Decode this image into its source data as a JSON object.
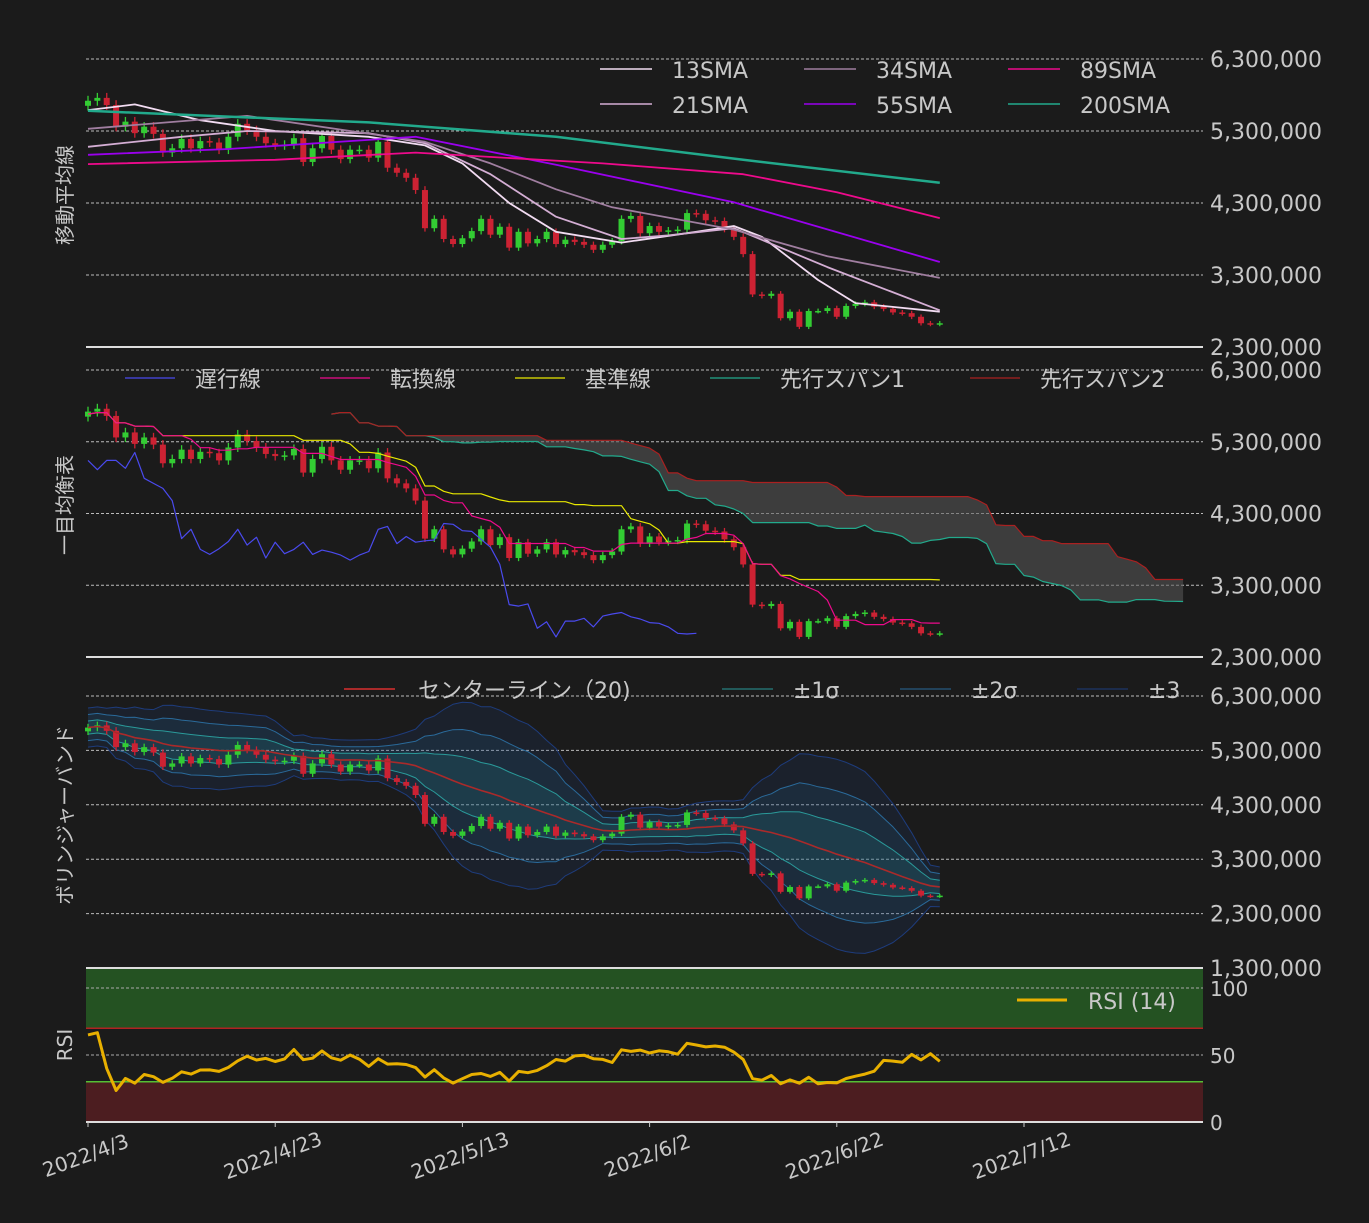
{
  "chart_data": [
    {
      "type": "candlestick",
      "panel": "moving-average",
      "ylabel": "移動平均線",
      "yticks": [
        "2,300,000",
        "3,300,000",
        "4,300,000",
        "5,300,000",
        "6,300,000"
      ],
      "ylim": [
        2300000,
        6300000
      ],
      "legend": [
        "13SMA",
        "21SMA",
        "34SMA",
        "55SMA",
        "89SMA",
        "200SMA"
      ],
      "legend_position": "top-right",
      "sma_series": [
        {
          "name": "13SMA",
          "color": "#f2dcf2",
          "points": [
            [
              0,
              5590000
            ],
            [
              5,
              5670000
            ],
            [
              12,
              5450000
            ],
            [
              20,
              5300000
            ],
            [
              30,
              5220000
            ],
            [
              36,
              5100000
            ],
            [
              40,
              4850000
            ],
            [
              45,
              4300000
            ],
            [
              50,
              3900000
            ],
            [
              57,
              3750000
            ],
            [
              65,
              3900000
            ],
            [
              69,
              3980000
            ],
            [
              72,
              3830000
            ],
            [
              78,
              3230000
            ],
            [
              82,
              2910000
            ],
            [
              91,
              2790000
            ]
          ]
        },
        {
          "name": "21SMA",
          "color": "#d4aed4",
          "points": [
            [
              0,
              5080000
            ],
            [
              10,
              5220000
            ],
            [
              17,
              5300000
            ],
            [
              30,
              5270000
            ],
            [
              36,
              5130000
            ],
            [
              43,
              4700000
            ],
            [
              50,
              4110000
            ],
            [
              57,
              3800000
            ],
            [
              62,
              3850000
            ],
            [
              69,
              3950000
            ],
            [
              79,
              3410000
            ],
            [
              91,
              2810000
            ]
          ]
        },
        {
          "name": "34SMA",
          "color": "#a07ea0",
          "points": [
            [
              0,
              5330000
            ],
            [
              17,
              5510000
            ],
            [
              28,
              5300000
            ],
            [
              36,
              5150000
            ],
            [
              43,
              4850000
            ],
            [
              50,
              4490000
            ],
            [
              56,
              4240000
            ],
            [
              69,
              3930000
            ],
            [
              79,
              3560000
            ],
            [
              91,
              3260000
            ]
          ]
        },
        {
          "name": "55SMA",
          "color": "#9a00ee",
          "points": [
            [
              0,
              4970000
            ],
            [
              15,
              5050000
            ],
            [
              35,
              5220000
            ],
            [
              50,
              4830000
            ],
            [
              69,
              4310000
            ],
            [
              91,
              3480000
            ]
          ]
        },
        {
          "name": "89SMA",
          "color": "#ee0a8c",
          "points": [
            [
              0,
              4840000
            ],
            [
              20,
              4900000
            ],
            [
              35,
              5000000
            ],
            [
              55,
              4850000
            ],
            [
              70,
              4700000
            ],
            [
              80,
              4450000
            ],
            [
              91,
              4090000
            ]
          ]
        },
        {
          "name": "200SMA",
          "color": "#22aa8c",
          "points": [
            [
              0,
              5580000
            ],
            [
              30,
              5420000
            ],
            [
              50,
              5220000
            ],
            [
              70,
              4900000
            ],
            [
              91,
              4580000
            ]
          ]
        }
      ]
    },
    {
      "type": "candlestick",
      "panel": "ichimoku",
      "ylabel": "一目均衡表",
      "yticks": [
        "2,300,000",
        "3,300,000",
        "4,300,000",
        "5,300,000",
        "6,300,000"
      ],
      "ylim": [
        2300000,
        6300000
      ],
      "legend": [
        "遅行線",
        "転換線",
        "基準線",
        "先行スパン1",
        "先行スパン2"
      ],
      "legend_position": "top",
      "periods": {
        "tenkan": 9,
        "kijun": 26,
        "span2": 52,
        "shift": 26
      },
      "colors": {
        "chikou": "#4a4aee",
        "tenkan": "#ee0a8c",
        "kijun": "#e8e800",
        "span1": "#22aa8c",
        "span2": "#aa2020",
        "cloud": "#5a5a5a"
      }
    },
    {
      "type": "candlestick",
      "panel": "bollinger",
      "ylabel": "ボリンジャーバンド",
      "yticks": [
        "1,300,000",
        "2,300,000",
        "3,300,000",
        "4,300,000",
        "5,300,000",
        "6,300,000"
      ],
      "ylim": [
        1300000,
        6300000
      ],
      "legend": [
        "センターライン（20)",
        "±1σ",
        "±2σ",
        "±3"
      ],
      "legend_position": "top-right",
      "period": 20,
      "colors": {
        "center": "#aa2a2a",
        "s1": "#2a9a9a",
        "s2": "#2a6a9a",
        "s3": "#1e3c7c"
      }
    },
    {
      "type": "line",
      "panel": "rsi",
      "ylabel": "RSI",
      "yticks": [
        "0",
        "50",
        "100"
      ],
      "ylim": [
        0,
        115
      ],
      "legend": [
        "RSI (14)"
      ],
      "legend_position": "top-right",
      "period": 14,
      "overbought": 70,
      "oversold": 30,
      "color": "#e8b000"
    }
  ],
  "x_axis": {
    "labels": [
      "2022/4/3",
      "2022/4/23",
      "2022/5/13",
      "2022/6/2",
      "2022/6/22",
      "2022/7/12"
    ],
    "label_day_index": [
      0,
      20,
      40,
      60,
      80,
      100
    ]
  },
  "candles": {
    "first_open": 5650000,
    "closes": [
      5720000,
      5760000,
      5660000,
      5360000,
      5430000,
      5270000,
      5360000,
      5260000,
      5000000,
      5060000,
      5190000,
      5060000,
      5160000,
      5140000,
      5040000,
      5220000,
      5400000,
      5310000,
      5220000,
      5130000,
      5100000,
      5110000,
      5200000,
      4870000,
      5060000,
      5230000,
      5040000,
      4910000,
      5040000,
      5040000,
      4930000,
      5150000,
      4790000,
      4720000,
      4650000,
      4480000,
      3950000,
      4080000,
      3800000,
      3730000,
      3810000,
      3910000,
      4080000,
      3860000,
      3970000,
      3680000,
      3900000,
      3740000,
      3800000,
      3900000,
      3730000,
      3790000,
      3760000,
      3720000,
      3650000,
      3720000,
      3770000,
      4080000,
      4120000,
      3880000,
      3980000,
      3900000,
      3920000,
      3930000,
      4160000,
      4150000,
      4060000,
      4050000,
      3940000,
      3830000,
      3590000,
      3030000,
      3010000,
      3040000,
      2700000,
      2790000,
      2580000,
      2800000,
      2800000,
      2840000,
      2720000,
      2870000,
      2900000,
      2920000,
      2860000,
      2830000,
      2780000,
      2770000,
      2720000,
      2630000,
      2620000,
      2630000
    ],
    "up_color": "#33cc33",
    "down_color": "#cc2233"
  }
}
